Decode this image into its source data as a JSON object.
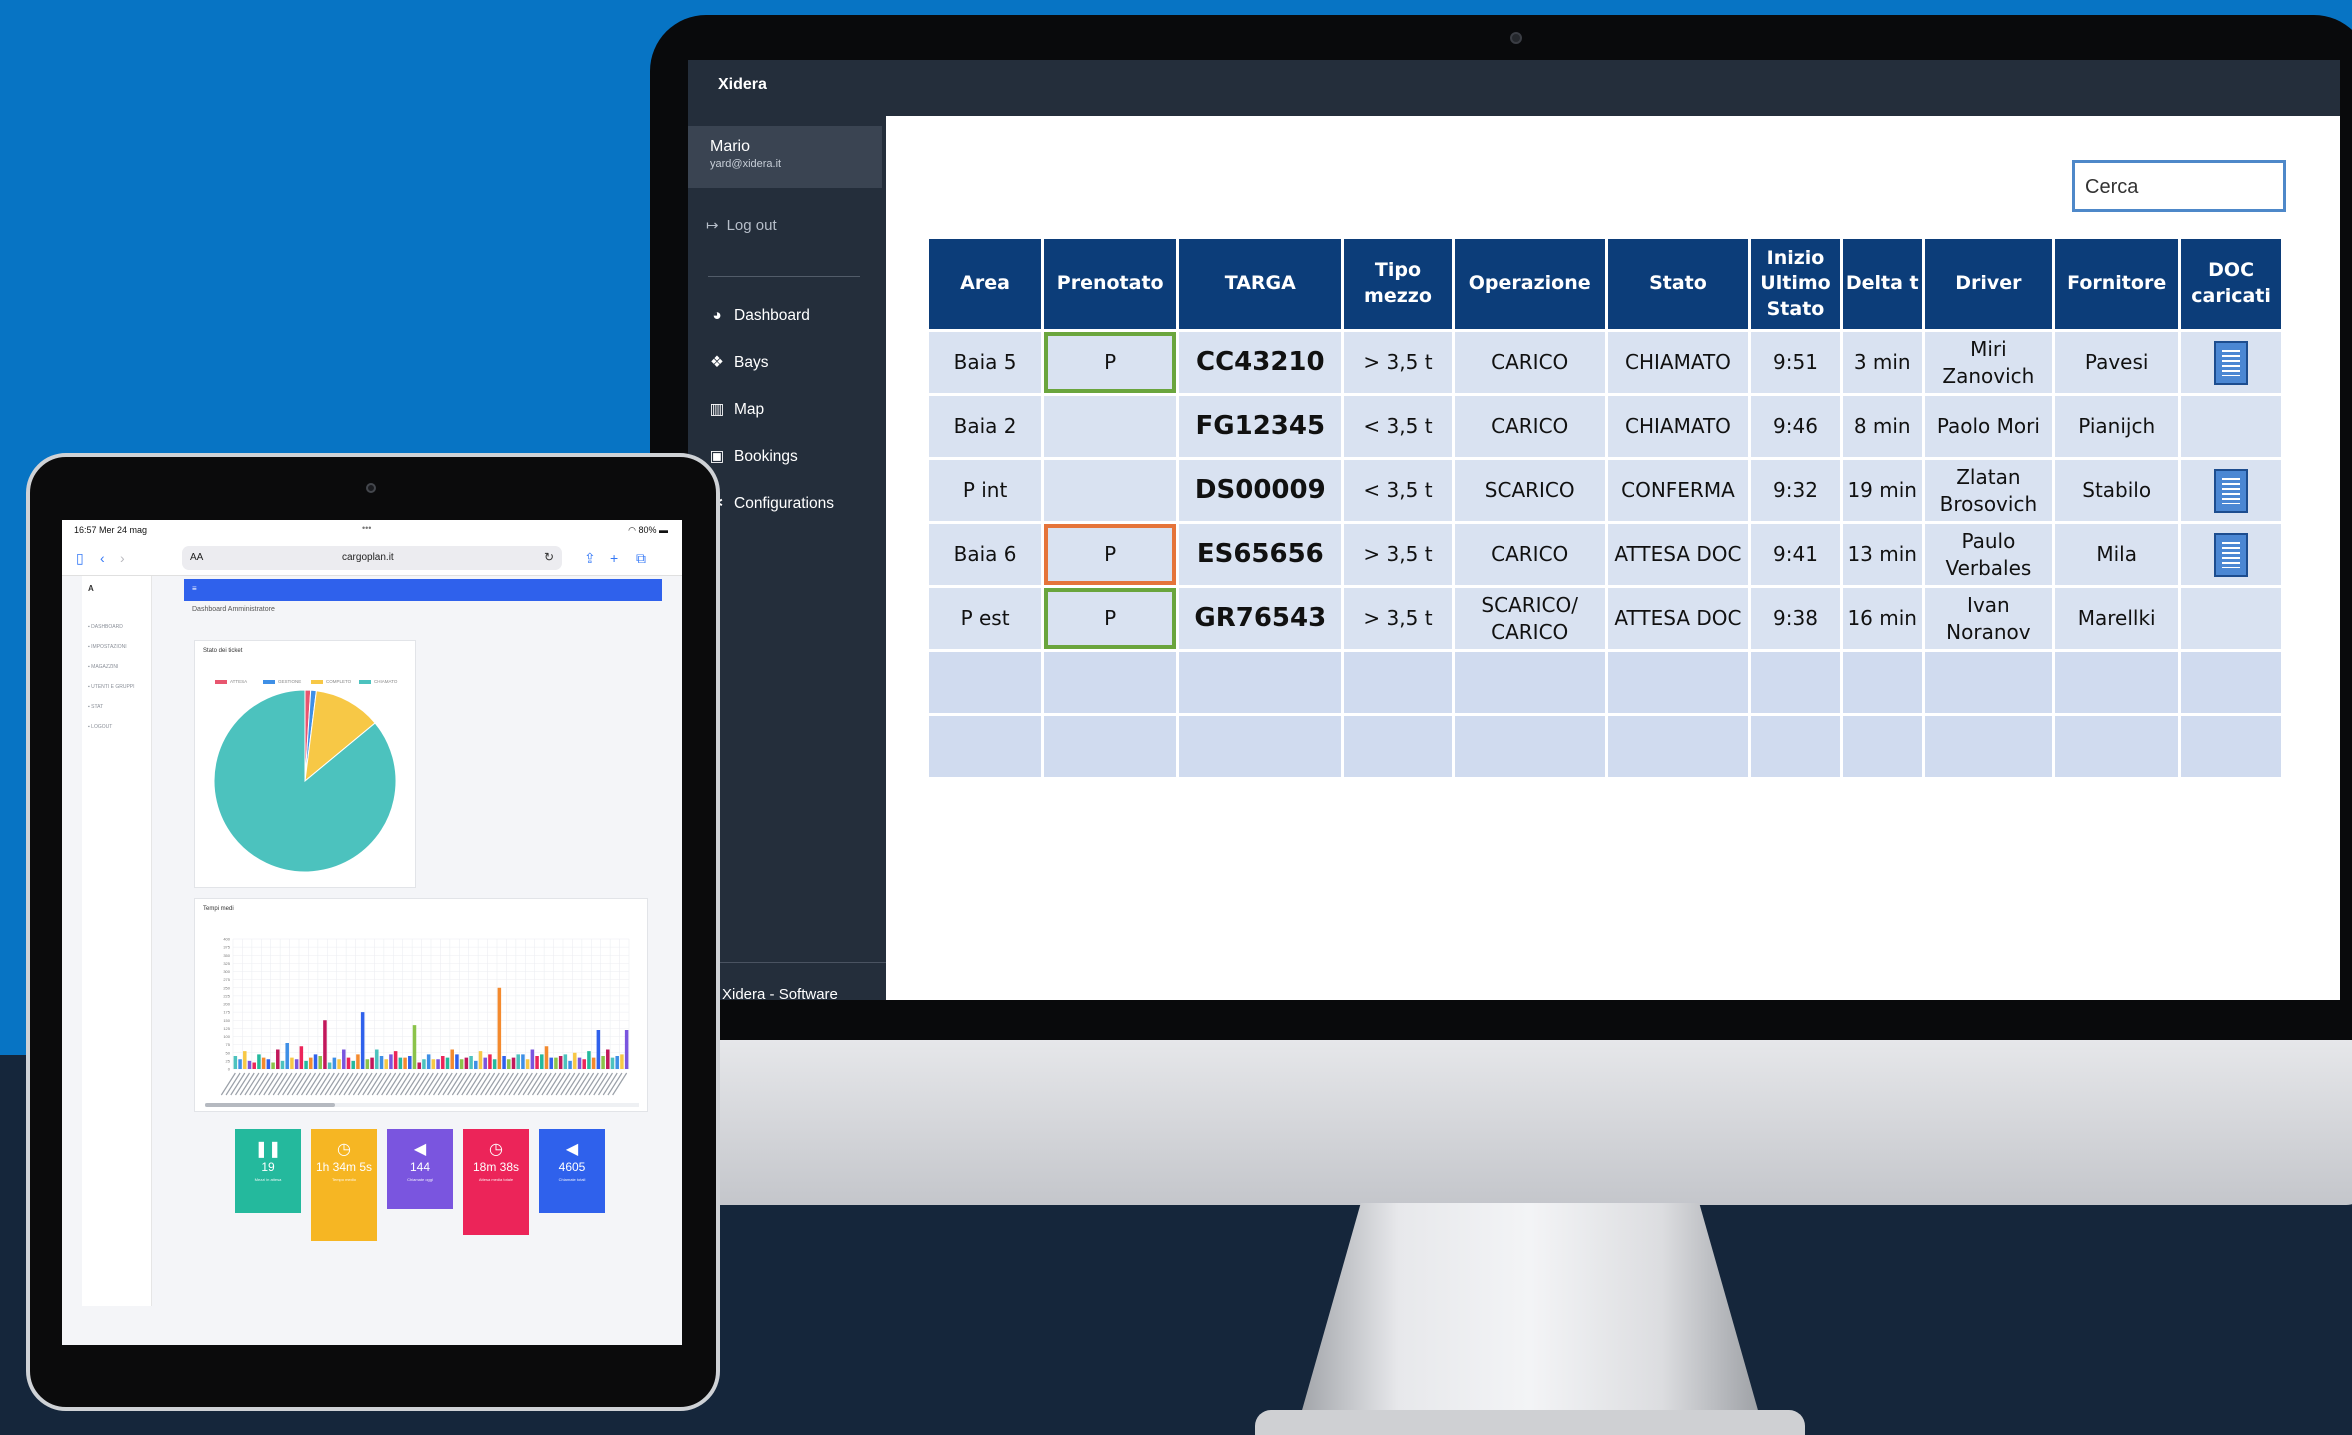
{
  "desktop_app": {
    "brand": "Xidera",
    "user": {
      "name": "Mario",
      "email": "yard@xidera.it"
    },
    "logout_label": "Log out",
    "nav": [
      {
        "label": "Dashboard",
        "icon": "pie-chart-icon"
      },
      {
        "label": "Bays",
        "icon": "cubes-icon"
      },
      {
        "label": "Map",
        "icon": "map-icon"
      },
      {
        "label": "Bookings",
        "icon": "calendar-icon"
      },
      {
        "label": "Configurations",
        "icon": "gear-icon"
      }
    ],
    "footer": "Xidera - Software",
    "search_placeholder": "Cerca",
    "table": {
      "headers": [
        "Area",
        "Prenotato",
        "TARGA",
        "Tipo mezzo",
        "Operazione",
        "Stato",
        "Inizio Ultimo Stato",
        "Delta t",
        "Driver",
        "Fornitore",
        "DOC caricati"
      ],
      "rows": [
        {
          "area": "Baia 5",
          "prenotato": "P",
          "prenotato_border": "#6aa53d",
          "targa": "CC43210",
          "tipo": "> 3,5 t",
          "operazione": "CARICO",
          "stato": "CHIAMATO",
          "inizio": "9:51",
          "delta": "3 min",
          "driver": "Miri Zanovich",
          "fornitore": "Pavesi",
          "doc": true
        },
        {
          "area": "Baia 2",
          "prenotato": "",
          "prenotato_border": "",
          "targa": "FG12345",
          "tipo": "< 3,5 t",
          "operazione": "CARICO",
          "stato": "CHIAMATO",
          "inizio": "9:46",
          "delta": "8 min",
          "driver": "Paolo Mori",
          "fornitore": "Pianijch",
          "doc": false
        },
        {
          "area": "P int",
          "prenotato": "",
          "prenotato_border": "",
          "targa": "DS00009",
          "tipo": "< 3,5 t",
          "operazione": "SCARICO",
          "stato": "CONFERMA",
          "inizio": "9:32",
          "delta": "19 min",
          "driver": "Zlatan Brosovich",
          "fornitore": "Stabilo",
          "doc": true
        },
        {
          "area": "Baia 6",
          "prenotato": "P",
          "prenotato_border": "#e5743a",
          "targa": "ES65656",
          "tipo": "> 3,5 t",
          "operazione": "CARICO",
          "stato": "ATTESA DOC",
          "inizio": "9:41",
          "delta": "13 min",
          "driver": "Paulo Verbales",
          "fornitore": "Mila",
          "doc": true
        },
        {
          "area": "P est",
          "prenotato": "P",
          "prenotato_border": "#6aa53d",
          "targa": "GR76543",
          "tipo": "> 3,5 t",
          "operazione": "SCARICO/ CARICO",
          "stato": "ATTESA DOC",
          "inizio": "9:38",
          "delta": "16 min",
          "driver": "Ivan Noranov",
          "fornitore": "Marellki",
          "doc": false
        }
      ],
      "empty_rows": 2
    }
  },
  "tablet": {
    "status_time": "16:57  Mer 24 mag",
    "status_battery": "80%",
    "browser_url": "cargoplan.it",
    "browser_aa": "AA",
    "dashboard_title": "Dashboard Amministratore",
    "side_nav": [
      "DASHBOARD",
      "IMPOSTAZIONI",
      "MAGAZZINI",
      "UTENTI E GRUPPI",
      "STAT",
      "LOGOUT"
    ],
    "pie_card_title": "Stato dei ticket",
    "bar_card_title": "Tempi medi",
    "pie_legend": [
      {
        "label": "ATTESA",
        "color": "#e8566f"
      },
      {
        "label": "GESTIONE",
        "color": "#3e8fe6"
      },
      {
        "label": "COMPLETO",
        "color": "#f7c846"
      },
      {
        "label": "CHIAMATO",
        "color": "#4cc2be"
      }
    ],
    "kpis": [
      {
        "value": "19",
        "label": "Mezzi in attesa",
        "color": "#24b99d",
        "icon": "pause-icon"
      },
      {
        "value": "1h 34m 5s",
        "label": "Tempo medio",
        "color": "#f6b623",
        "icon": "clock-icon"
      },
      {
        "value": "144",
        "label": "Chiamate oggi",
        "color": "#7a55df",
        "icon": "megaphone-icon"
      },
      {
        "value": "18m 38s",
        "label": "Attesa media totale",
        "color": "#ec2459",
        "icon": "clock-icon"
      },
      {
        "value": "4605",
        "label": "Chiamate totali",
        "color": "#2f61ec",
        "icon": "megaphone-icon"
      }
    ]
  },
  "chart_data": [
    {
      "type": "pie",
      "title": "Stato dei ticket",
      "labels": [
        "ATTESA",
        "GESTIONE",
        "COMPLETO",
        "CHIAMATO"
      ],
      "values": [
        1,
        1,
        12,
        86
      ],
      "colors": [
        "#e8566f",
        "#3e8fe6",
        "#f7c846",
        "#4cc2be"
      ]
    },
    {
      "type": "bar",
      "title": "Tempi medi",
      "ylim": [
        0,
        400
      ],
      "y_ticks": [
        0,
        25,
        50,
        75,
        100,
        125,
        150,
        175,
        200,
        225,
        250,
        275,
        300,
        325,
        350,
        375,
        400
      ],
      "values": [
        40,
        30,
        55,
        25,
        20,
        45,
        35,
        30,
        20,
        60,
        25,
        80,
        35,
        30,
        70,
        25,
        35,
        45,
        40,
        150,
        20,
        35,
        30,
        60,
        35,
        25,
        45,
        175,
        30,
        35,
        60,
        40,
        30,
        45,
        55,
        35,
        35,
        40,
        135,
        20,
        30,
        45,
        30,
        30,
        40,
        35,
        60,
        45,
        30,
        35,
        40,
        25,
        55,
        35,
        45,
        30,
        250,
        40,
        30,
        35,
        45,
        45,
        30,
        60,
        40,
        45,
        70,
        35,
        35,
        40,
        45,
        25,
        50,
        35,
        30,
        55,
        35,
        120,
        40,
        60,
        35,
        40,
        45,
        120
      ],
      "colors": [
        "#4cc2be",
        "#3e8fe6",
        "#f7c846",
        "#7a55df",
        "#ec2459",
        "#24b99d",
        "#f48a2e",
        "#2f61ec",
        "#8bc34a",
        "#c2185b"
      ]
    }
  ]
}
